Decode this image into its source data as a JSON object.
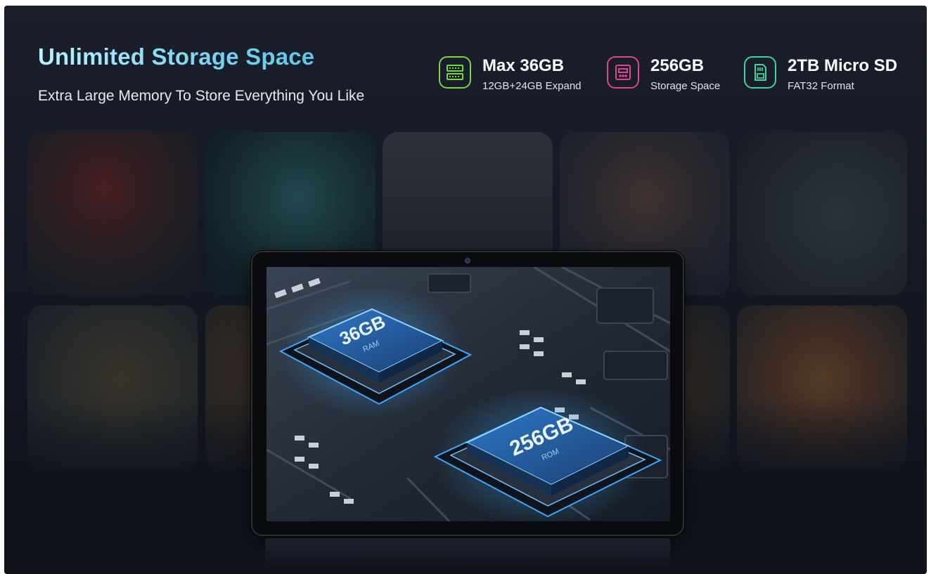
{
  "header": {
    "title": "Unlimited Storage Space",
    "subtitle": "Extra Large Memory To  Store Everything You Like"
  },
  "features": [
    {
      "icon": "ram-icon",
      "color": "#7bd63b",
      "value": "Max 36GB",
      "desc": "12GB+24GB Expand"
    },
    {
      "icon": "storage-chip-icon",
      "color": "#e0458f",
      "value": "256GB",
      "desc": "Storage Space"
    },
    {
      "icon": "sd-card-icon",
      "color": "#3dd3a2",
      "value": "2TB Micro SD",
      "desc": "FAT32 Format"
    }
  ],
  "tablet_screen": {
    "chip_ram_label": "36GB",
    "chip_ram_sub": "RAM",
    "chip_rom_label": "256GB",
    "chip_rom_sub": "ROM"
  },
  "colors": {
    "background": "#141925",
    "title_gradient_start": "#b9f1ff",
    "title_gradient_end": "#5ec5e6",
    "chip_glow": "#3aa8ff"
  }
}
